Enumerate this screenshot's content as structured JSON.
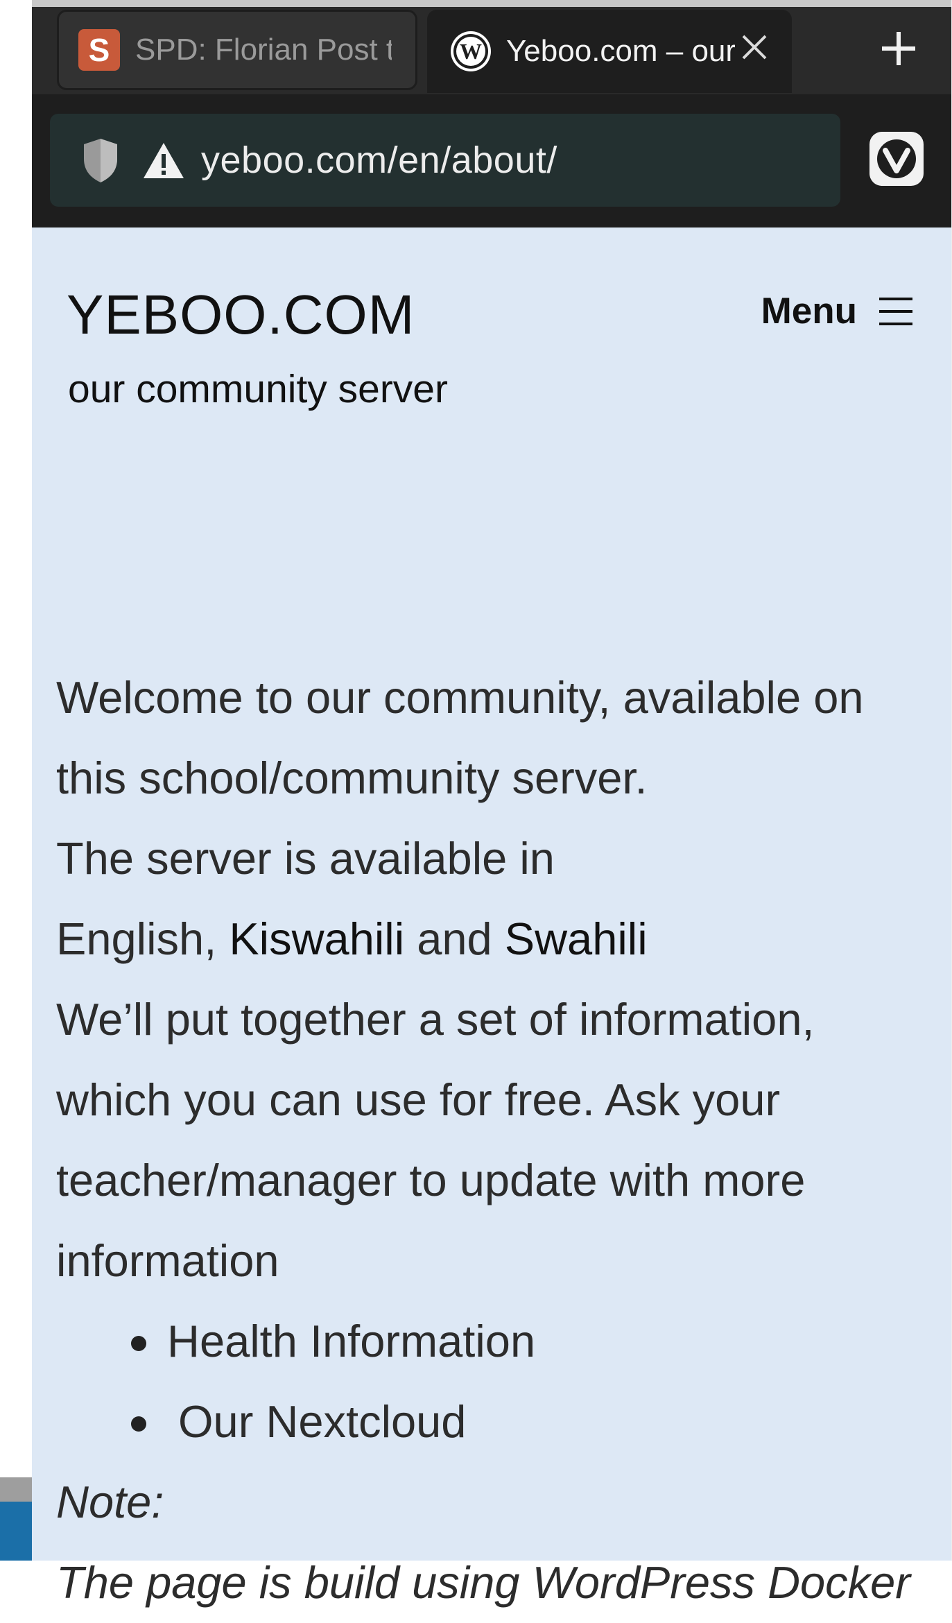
{
  "browser": {
    "tabs": [
      {
        "title": "SPD: Florian Post tr",
        "favicon": "s-logo-icon",
        "active": false
      },
      {
        "title": "Yeboo.com – our",
        "favicon": "wordpress-icon",
        "active": true
      }
    ],
    "new_tab_icon": "plus-icon",
    "url": "yeboo.com/en/about/",
    "colors": {
      "tabstrip": "#2a2a2a",
      "urlbar": "#233030",
      "page_bg": "#dde8f5"
    }
  },
  "site": {
    "title": "YEBOO.COM",
    "tagline": "our community server",
    "menu_label": "Menu"
  },
  "content": {
    "paragraph1": "Welcome to our community, available on this school/community server.",
    "paragraph2_prefix": "The server is available in",
    "languages": {
      "english": "English",
      "sep1": ", ",
      "kiswahili": "Kiswahili",
      "and": " and ",
      "swahili": "Swahili"
    },
    "paragraph3": "We’ll put together a set of information, which you can use for free. Ask your teacher/manager to update with more information",
    "list_items": [
      "Health Information",
      "Our Nextcloud"
    ],
    "note_label": "Note:",
    "partial_next_line": "The page is build using WordPress Docker"
  }
}
